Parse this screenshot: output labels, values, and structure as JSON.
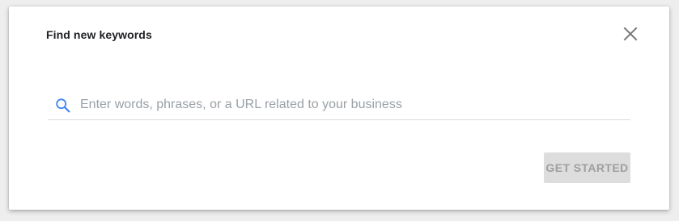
{
  "dialog": {
    "title": "Find new keywords",
    "close_icon": "close-icon"
  },
  "search": {
    "icon": "search-icon",
    "value": "",
    "placeholder": "Enter words, phrases, or a URL related to your business",
    "icon_color": "#4285f4"
  },
  "actions": {
    "get_started_label": "GET STARTED",
    "get_started_enabled": false
  }
}
